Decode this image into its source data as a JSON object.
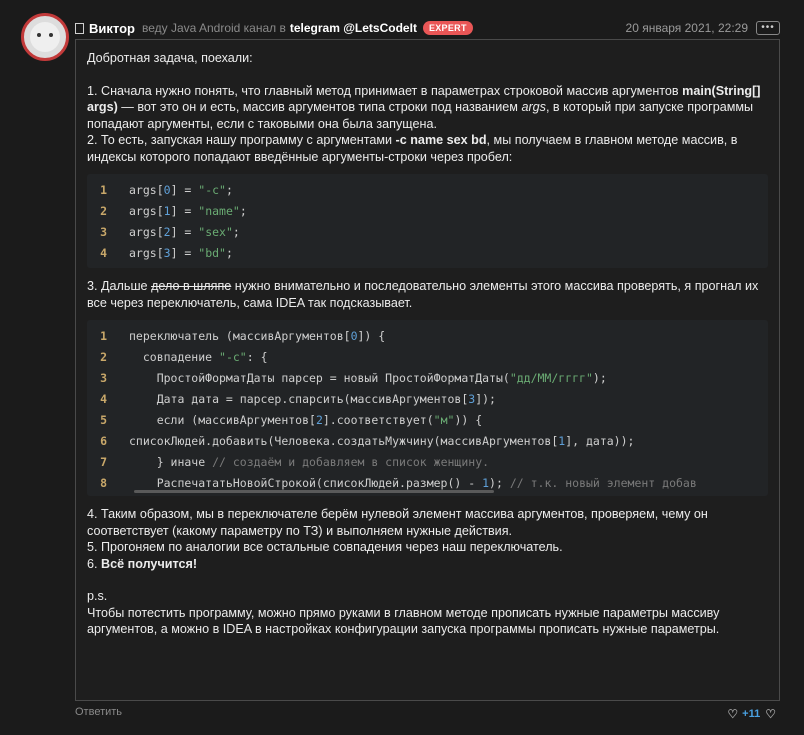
{
  "header": {
    "username": "Виктор",
    "lead_text": "веду Java Android канал в",
    "channel": "telegram @LetsCodeIt",
    "badge": "EXPERT",
    "date": "20 января 2021, 22:29",
    "more_label": "•••"
  },
  "post": {
    "intro": "Добротная задача, поехали:",
    "p1_a": "1. Сначала нужно понять, что главный метод принимает в параметрах строковой массив аргументов ",
    "p1_b": "main(String[] args)",
    "p1_c": " — вот это он и есть, массив аргументов типа строки под названием ",
    "p1_d": "args",
    "p1_e": ", в который при запуске программы попадают аргументы, если с таковыми она была запущена.",
    "p2_a": "2. То есть, запуская нашу программу с аргументами ",
    "p2_b": "-c name sex bd",
    "p2_c": ", мы получаем в главном методе массив, в индексы которого попадают введённые аргументы-строки через пробел:",
    "code1": [
      {
        "n": "1",
        "a": "args[",
        "idx": "0",
        "b": "] = ",
        "s": "\"-c\"",
        "e": ";"
      },
      {
        "n": "2",
        "a": "args[",
        "idx": "1",
        "b": "] = ",
        "s": "\"name\"",
        "e": ";"
      },
      {
        "n": "3",
        "a": "args[",
        "idx": "2",
        "b": "] = ",
        "s": "\"sex\"",
        "e": ";"
      },
      {
        "n": "4",
        "a": "args[",
        "idx": "3",
        "b": "] = ",
        "s": "\"bd\"",
        "e": ";"
      }
    ],
    "p3_a": "3. Дальше ",
    "p3_strike": "дело в шляпе",
    "p3_b": " нужно внимательно и последовательно элементы этого массива проверять, я прогнал их все через переключатель, сама IDEA так подсказывает.",
    "code2": {
      "l1_n": "1",
      "l1_a": "переключатель (массивАргументов[",
      "l1_num": "0",
      "l1_b": "]) {",
      "l2_n": "2",
      "l2_a": "  совпадение ",
      "l2_s": "\"-c\"",
      "l2_b": ": {",
      "l3_n": "3",
      "l3_a": "    ПростойФорматДаты парсер = новый ПростойФорматДаты(",
      "l3_s": "\"дд/ММ/гггг\"",
      "l3_b": ");",
      "l4_n": "4",
      "l4_a": "    Дата дата = парсер.спарсить(массивАргументов[",
      "l4_num": "3",
      "l4_b": "]);",
      "l5_n": "5",
      "l5_a": "    если (массивАргументов[",
      "l5_num": "2",
      "l5_b": "].соответствует(",
      "l5_s": "\"м\"",
      "l5_c": ")) {",
      "l6_n": "6",
      "l6_a": "списокЛюдей.добавить(Человека.создатьМужчину(массивАргументов[",
      "l6_num": "1",
      "l6_b": "], дата));",
      "l7_n": "7",
      "l7_a": "    } иначе ",
      "l7_c": "// создаём и добавляем в список женщину.",
      "l8_n": "8",
      "l8_a": "    РаспечататьНовойСтрокой(списокЛюдей.размер() - ",
      "l8_num": "1",
      "l8_b": "); ",
      "l8_c": "// т.к. новый элемент добав"
    },
    "p4": "4. Таким образом, мы в переключателе берём нулевой элемент массива аргументов, проверяем, чему он соответствует (какому параметру по ТЗ) и выполняем нужные действия.",
    "p5": "5. Прогоняем по аналогии все остальные совпадения через наш переключатель.",
    "p6_a": "6. ",
    "p6_b": "Всё получится!",
    "ps": "p.s.",
    "ps_text": "Чтобы потестить программу, можно прямо руками в главном методе прописать нужные параметры массиву аргументов, а можно в IDEA в настройках конфигурации запуска программы прописать нужные параметры."
  },
  "footer": {
    "reply": "Ответить",
    "likes": "+11"
  }
}
